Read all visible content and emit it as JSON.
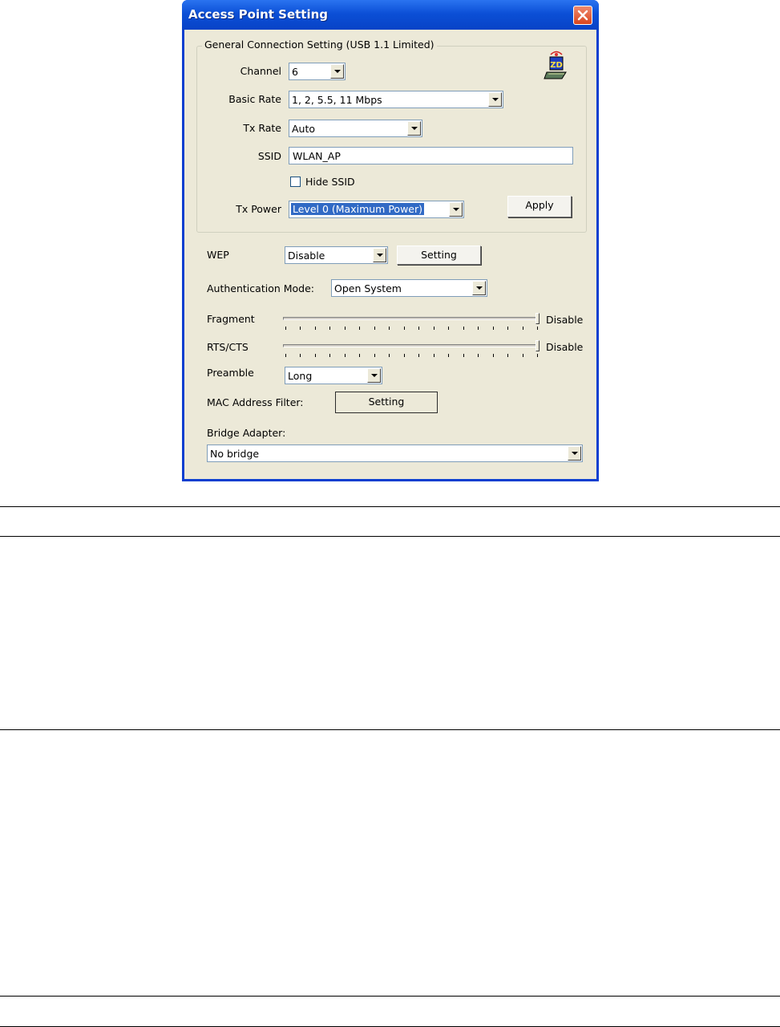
{
  "window": {
    "title": "Access Point Setting"
  },
  "general": {
    "group_title": "General Connection Setting (USB 1.1 Limited)",
    "channel_label": "Channel",
    "channel_value": "6",
    "basic_rate_label": "Basic Rate",
    "basic_rate_value": "1, 2, 5.5, 11 Mbps",
    "tx_rate_label": "Tx Rate",
    "tx_rate_value": "Auto",
    "ssid_label": "SSID",
    "ssid_value": "WLAN_AP",
    "hide_ssid_label": "Hide SSID",
    "hide_ssid_checked": false,
    "tx_power_label": "Tx Power",
    "tx_power_value": "Level 0 (Maximum Power)",
    "apply_label": "Apply"
  },
  "security": {
    "wep_label": "WEP",
    "wep_value": "Disable",
    "wep_setting_label": "Setting",
    "auth_label": "Authentication Mode:",
    "auth_value": "Open System",
    "fragment_label": "Fragment",
    "fragment_value": "Disable",
    "fragment_level": 1.0,
    "rts_label": "RTS/CTS",
    "rts_value": "Disable",
    "rts_level": 1.0,
    "preamble_label": "Preamble",
    "preamble_value": "Long",
    "mac_filter_label": "MAC Address Filter:",
    "mac_setting_label": "Setting",
    "bridge_label": "Bridge Adapter:",
    "bridge_value": "No bridge"
  },
  "icons": {
    "close": "close-icon",
    "device": "zd-wireless-device-icon",
    "dropdown": "chevron-down-icon"
  },
  "colors": {
    "titlebar": "#0b4fd6",
    "dialog_bg": "#ece9d8",
    "selection": "#316ac5",
    "close_button": "#d9451e"
  }
}
